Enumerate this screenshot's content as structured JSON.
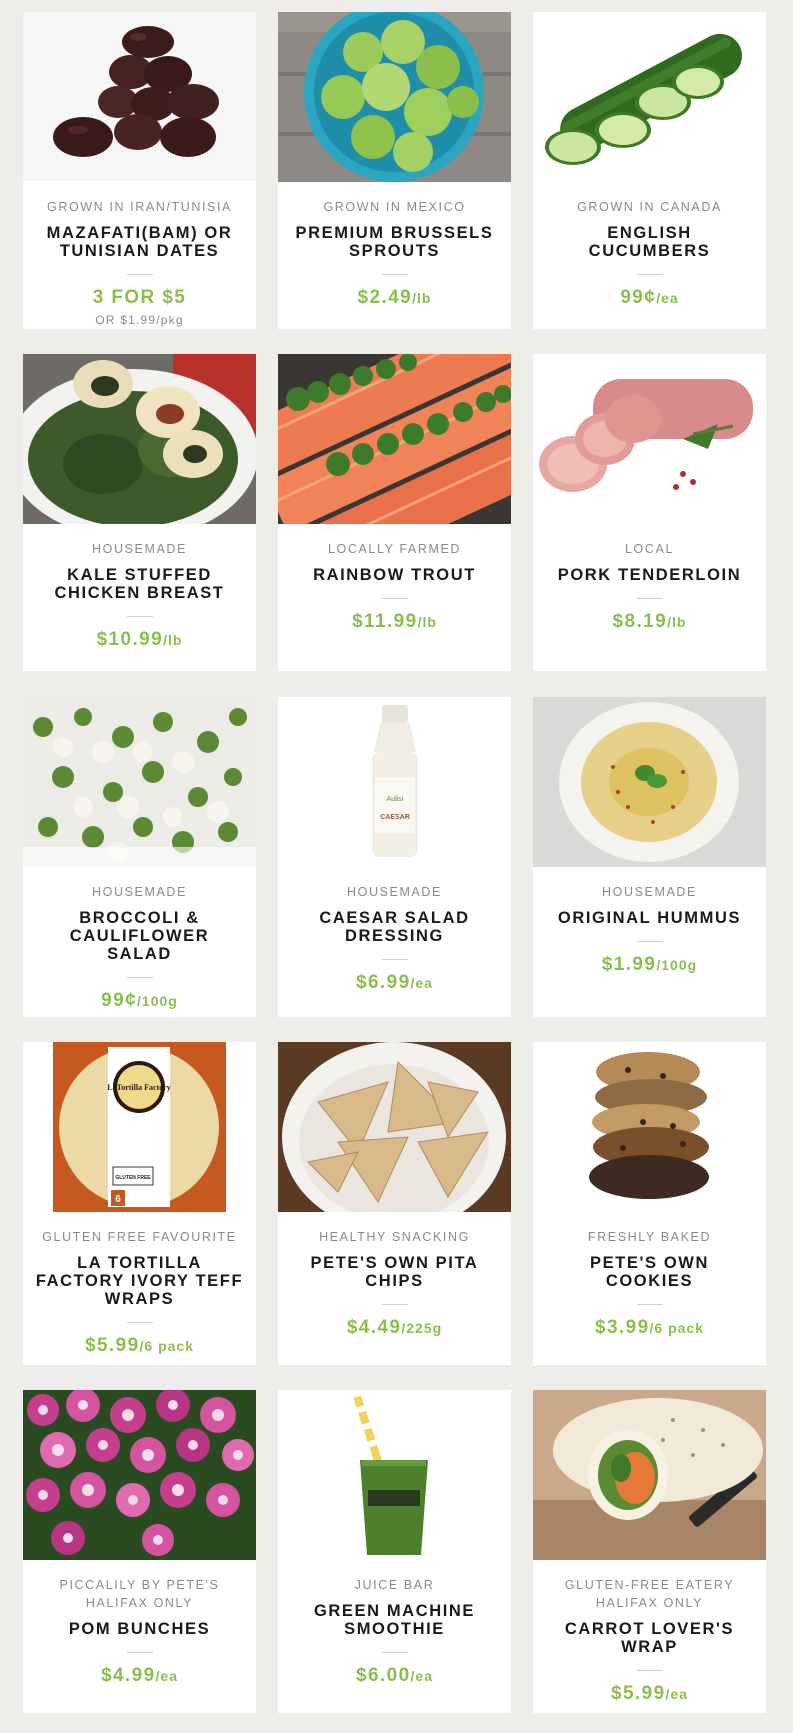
{
  "products": [
    {
      "origin": "GROWN IN IRAN/TUNISIA",
      "title": "MAZAFATI(BAM) OR TUNISIAN DATES",
      "price": "3 FOR $5",
      "unit": "",
      "sub": "OR $1.99/pkg",
      "image": "dates-photo"
    },
    {
      "origin": "GROWN IN MEXICO",
      "title": "PREMIUM BRUSSELS SPROUTS",
      "price": "$2.49",
      "unit": "/lb",
      "sub": "",
      "image": "brussels-sprouts-photo"
    },
    {
      "origin": "GROWN IN CANADA",
      "title": "ENGLISH CUCUMBERS",
      "price": "99¢",
      "unit": "/ea",
      "sub": "",
      "image": "cucumbers-photo"
    },
    {
      "origin": "HOUSEMADE",
      "title": "KALE STUFFED CHICKEN BREAST",
      "price": "$10.99",
      "unit": "/lb",
      "sub": "",
      "image": "stuffed-chicken-photo"
    },
    {
      "origin": "LOCALLY FARMED",
      "title": "RAINBOW TROUT",
      "price": "$11.99",
      "unit": "/lb",
      "sub": "",
      "image": "trout-photo"
    },
    {
      "origin": "LOCAL",
      "title": "PORK TENDERLOIN",
      "price": "$8.19",
      "unit": "/lb",
      "sub": "",
      "image": "pork-photo"
    },
    {
      "origin": "HOUSEMADE",
      "title": "BROCCOLI & CAULIFLOWER SALAD",
      "price": "99¢",
      "unit": "/100g",
      "sub": "",
      "image": "salad-photo"
    },
    {
      "origin": "HOUSEMADE",
      "title": "CAESAR SALAD DRESSING",
      "price": "$6.99",
      "unit": "/ea",
      "sub": "",
      "image": "dressing-bottle-photo"
    },
    {
      "origin": "HOUSEMADE",
      "title": "ORIGINAL HUMMUS",
      "price": "$1.99",
      "unit": "/100g",
      "sub": "",
      "image": "hummus-photo"
    },
    {
      "origin": "GLUTEN FREE FAVOURITE",
      "title": "LA TORTILLA FACTORY IVORY TEFF WRAPS",
      "price": "$5.99",
      "unit": "/6 pack",
      "sub": "",
      "image": "tortilla-package-photo"
    },
    {
      "origin": "HEALTHY SNACKING",
      "title": "PETE'S OWN PITA CHIPS",
      "price": "$4.49",
      "unit": "/225g",
      "sub": "",
      "image": "pita-chips-photo"
    },
    {
      "origin": "FRESHLY BAKED",
      "title": "PETE'S OWN COOKIES",
      "price": "$3.99",
      "unit": "/6 pack",
      "sub": "",
      "image": "cookies-photo"
    },
    {
      "origin": "PICCALILY BY PETE'S HALIFAX ONLY",
      "title": "POM BUNCHES",
      "price": "$4.99",
      "unit": "/ea",
      "sub": "",
      "image": "flowers-photo"
    },
    {
      "origin": "JUICE BAR",
      "title": "GREEN MACHINE SMOOTHIE",
      "price": "$6.00",
      "unit": "/ea",
      "sub": "",
      "image": "smoothie-photo"
    },
    {
      "origin": "GLUTEN-FREE EATERY HALIFAX ONLY",
      "title": "CARROT LOVER'S WRAP",
      "price": "$5.99",
      "unit": "/ea",
      "sub": "",
      "image": "wrap-photo"
    }
  ],
  "tortilla_package": {
    "brand": "LaTortilla Factory",
    "badge": "GLUTEN FREE",
    "count": "6"
  },
  "dressing_label": "CAESAR",
  "colors": {
    "price_green": "#8cbd4f",
    "background": "#efedea"
  }
}
